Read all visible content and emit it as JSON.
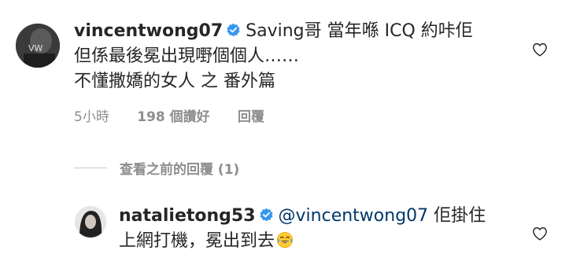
{
  "comment": {
    "username": "vincentwong07",
    "text_line1": "Saving哥 當年喺 ICQ 約咔佢",
    "text_line2": "但係最後冕出現嘢個個人……",
    "text_line3": "不懂撒嬌的女人 之 番外篇",
    "time": "5小時",
    "likes": "198 個讚好",
    "reply_label": "回覆"
  },
  "view_previous": {
    "label": "查看之前的回覆 (1)"
  },
  "reply": {
    "username": "natalietong53",
    "mention": "@vincentwong07",
    "text_a": " 佢掛住",
    "text_b": "上網打機，冕出到去"
  },
  "icons": {
    "verified": "verified-badge-icon",
    "heart": "heart-outline-icon",
    "emoji": "tears-of-joy-emoji"
  },
  "colors": {
    "text": "#262626",
    "secondary": "#8e8e8e",
    "verified": "#3897f0",
    "mention": "#00376b"
  }
}
